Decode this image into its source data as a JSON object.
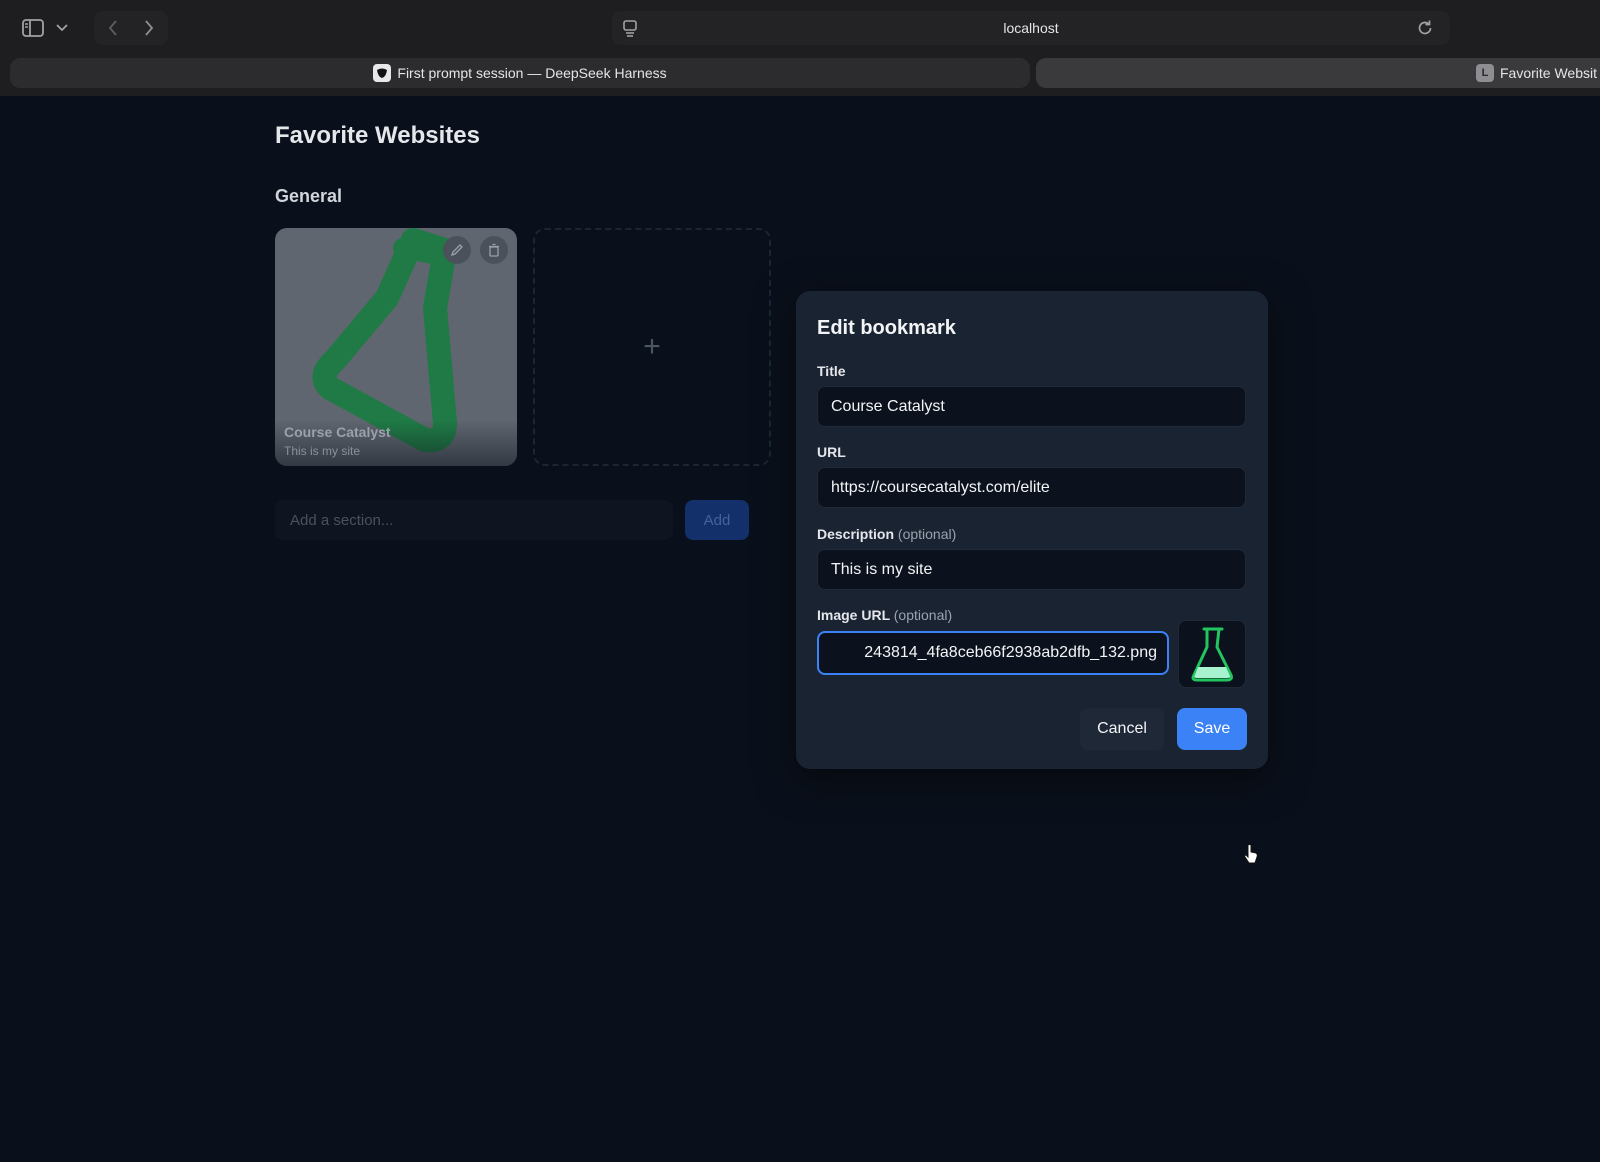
{
  "browser": {
    "url": "localhost",
    "tabs": [
      {
        "label": "First prompt session — DeepSeek Harness",
        "active": false
      },
      {
        "label": "Favorite Websit",
        "active": true,
        "icon_letter": "L"
      }
    ]
  },
  "page": {
    "title": "Favorite Websites",
    "section": "General",
    "card": {
      "title": "Course Catalyst",
      "description": "This is my site",
      "icon": "flask-icon"
    },
    "add_card_symbol": "+",
    "section_input_placeholder": "Add a section...",
    "add_button": "Add"
  },
  "modal": {
    "title": "Edit bookmark",
    "fields": {
      "title_label": "Title",
      "title_value": "Course Catalyst",
      "url_label": "URL",
      "url_value": "https://coursecatalyst.com/elite",
      "description_label": "Description",
      "description_optional": "(optional)",
      "description_value": "This is my site",
      "image_label": "Image URL",
      "image_optional": "(optional)",
      "image_value": "243814_4fa8ceb66f2938ab2dfb_132.png"
    },
    "cancel_button": "Cancel",
    "save_button": "Save"
  },
  "colors": {
    "accent": "#3b82f6",
    "background": "#0a101b",
    "modal": "#1a2332",
    "flask_green": "#1f8a4c"
  }
}
